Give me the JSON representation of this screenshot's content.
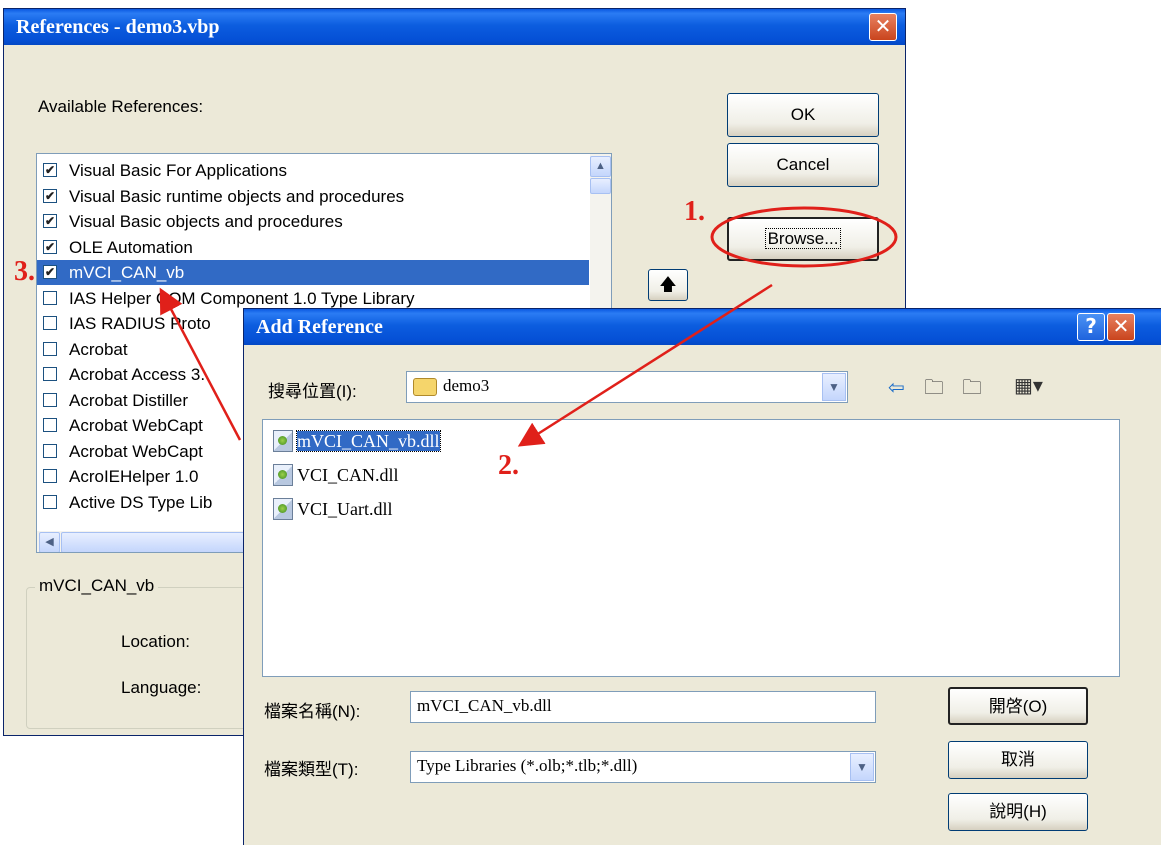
{
  "references_dialog": {
    "title": "References - demo3.vbp",
    "available_label": "Available References:",
    "items": [
      {
        "label": "Visual Basic For Applications",
        "checked": true
      },
      {
        "label": "Visual Basic runtime objects and procedures",
        "checked": true
      },
      {
        "label": "Visual Basic objects and procedures",
        "checked": true
      },
      {
        "label": "OLE Automation",
        "checked": true
      },
      {
        "label": "mVCI_CAN_vb",
        "checked": true
      },
      {
        "label": "IAS Helper COM Component 1.0 Type Library",
        "checked": false
      },
      {
        "label": "IAS RADIUS Proto",
        "checked": false
      },
      {
        "label": "Acrobat",
        "checked": false
      },
      {
        "label": "Acrobat Access 3.",
        "checked": false
      },
      {
        "label": "Acrobat Distiller",
        "checked": false
      },
      {
        "label": "Acrobat WebCapt",
        "checked": false
      },
      {
        "label": "Acrobat WebCapt",
        "checked": false
      },
      {
        "label": "AcroIEHelper 1.0",
        "checked": false
      },
      {
        "label": "Active DS Type Lib",
        "checked": false
      }
    ],
    "ok_label": "OK",
    "cancel_label": "Cancel",
    "browse_label": "Browse...",
    "group_title": "mVCI_CAN_vb",
    "location_label": "Location:",
    "language_label": "Language:"
  },
  "add_reference_dialog": {
    "title": "Add Reference",
    "look_in_label": "搜尋位置(I):",
    "look_in_value": "demo3",
    "files": [
      "mVCI_CAN_vb.dll",
      "VCI_CAN.dll",
      "VCI_Uart.dll"
    ],
    "filename_label": "檔案名稱(N):",
    "filename_value": "mVCI_CAN_vb.dll",
    "filetype_label": "檔案類型(T):",
    "filetype_value": "Type Libraries (*.olb;*.tlb;*.dll)",
    "open_label": "開啓(O)",
    "cancel_label": "取消",
    "help_label": "說明(H)"
  },
  "annotations": {
    "step1": "1.",
    "step2": "2.",
    "step3": "3."
  },
  "colors": {
    "annotation": "#e0201a",
    "selection": "#316ac5",
    "titlebar": "#0550d6"
  }
}
